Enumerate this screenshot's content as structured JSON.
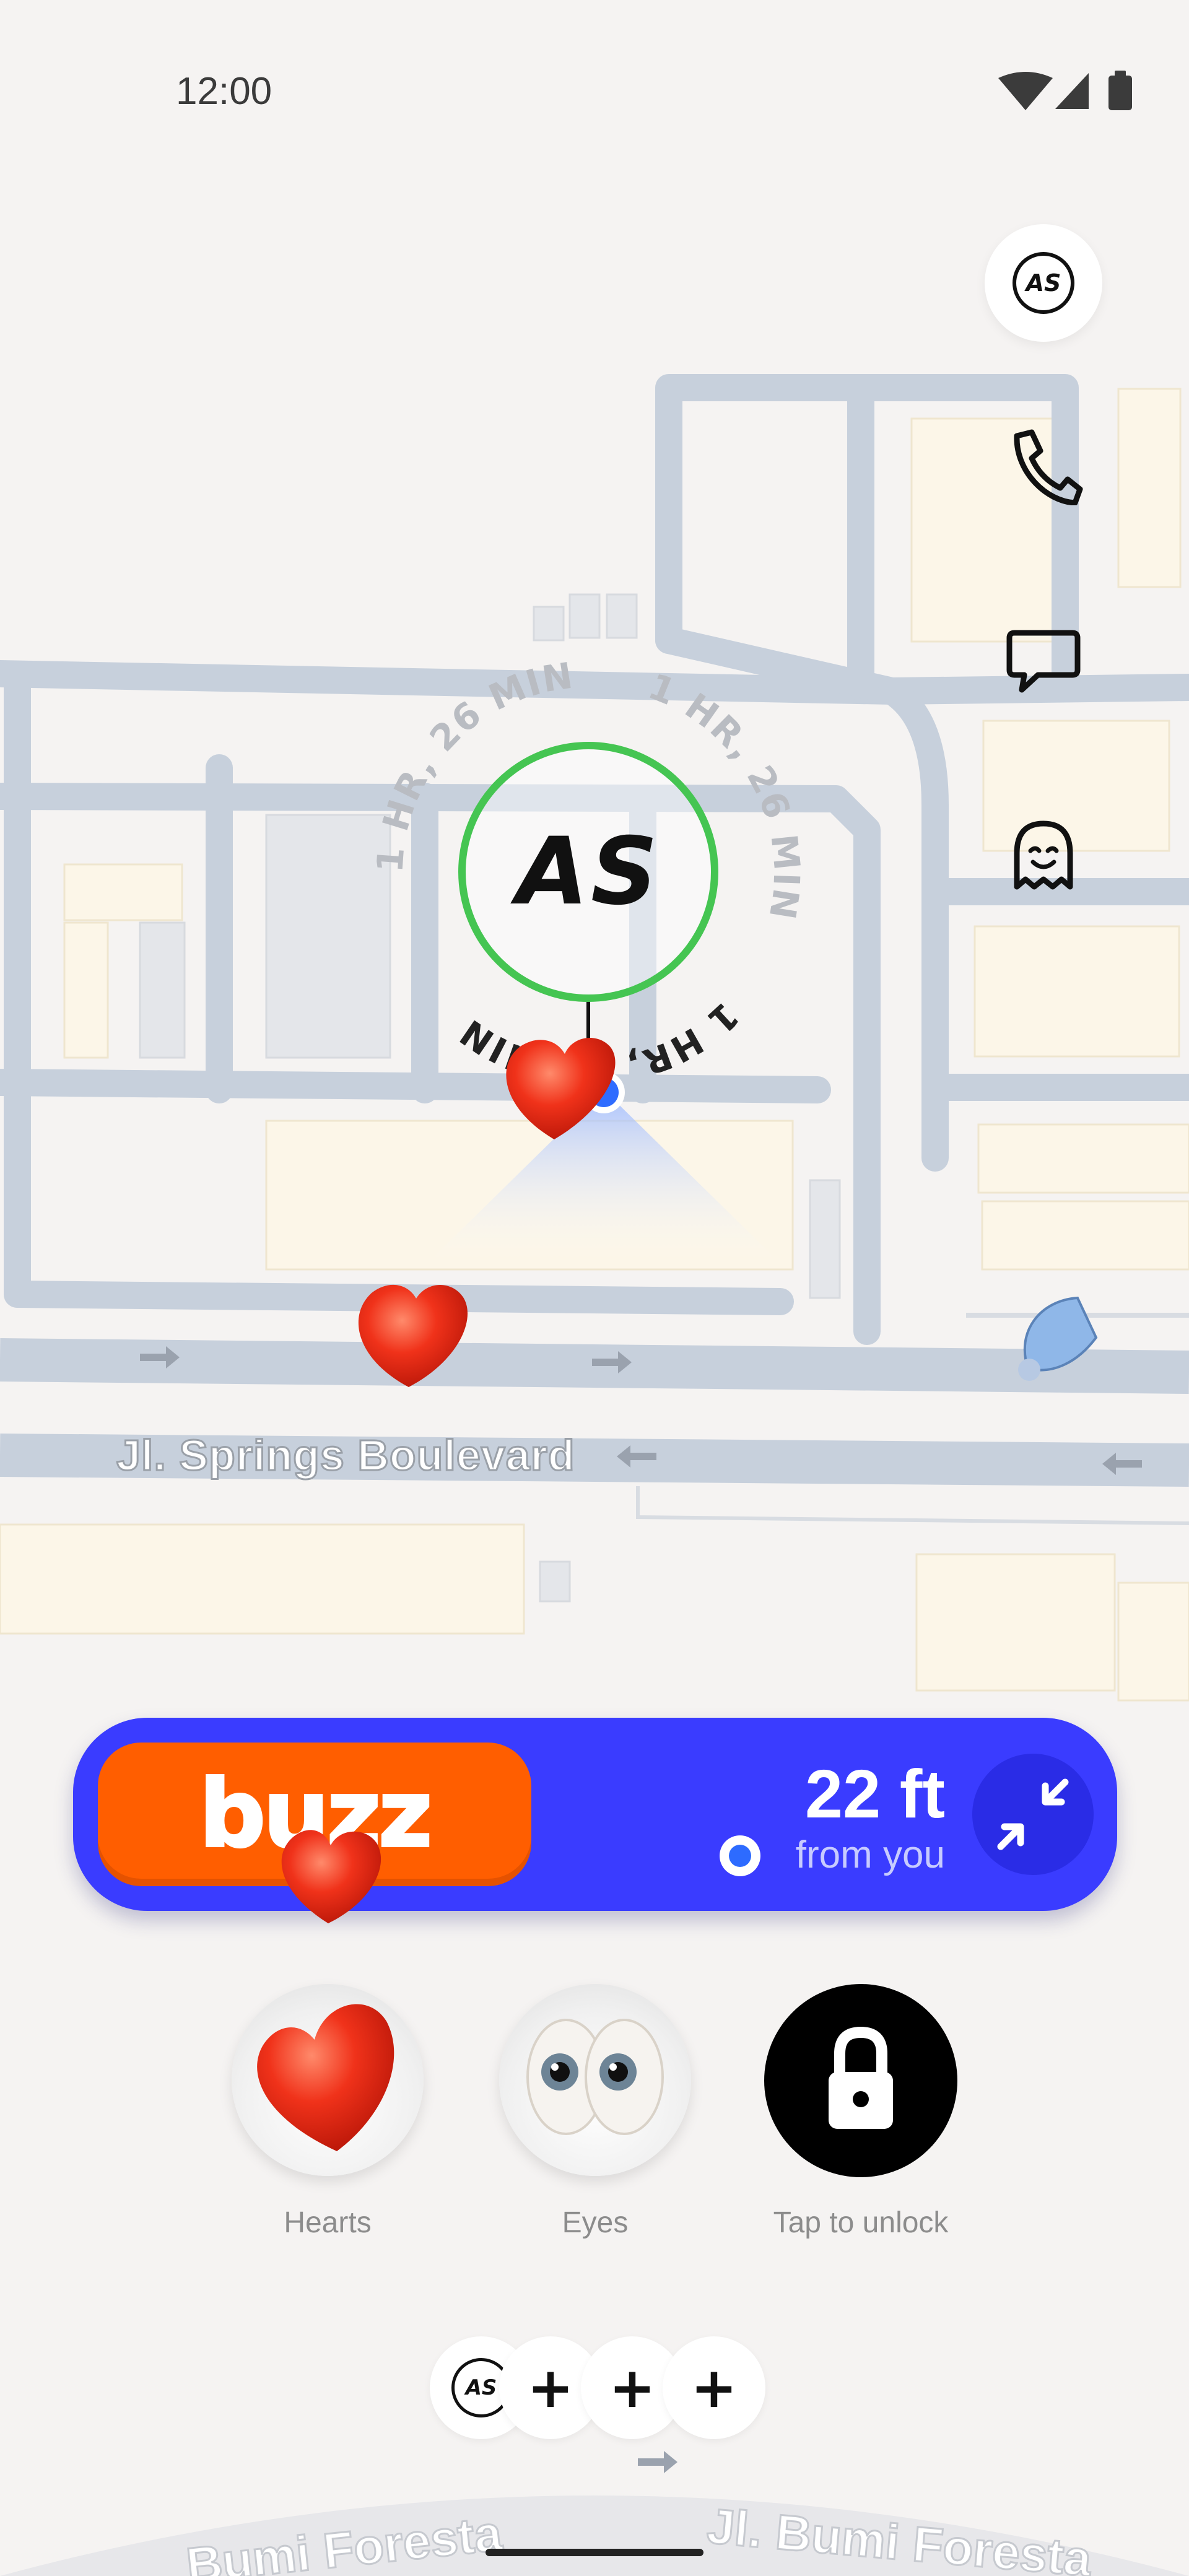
{
  "status_bar": {
    "time": "12:00"
  },
  "map": {
    "friend": {
      "initials": "AS",
      "eta_text": "1 HR, 26 MIN"
    },
    "street_label": "Jl. Springs Boulevard",
    "bottom_street_left": "Bumi Foresta",
    "bottom_street_right": "Jl. Bumi Foresta"
  },
  "right_rail": {
    "avatar_initials": "AS",
    "icons": [
      "phone-icon",
      "chat-icon",
      "ghost-icon"
    ]
  },
  "buzz_bar": {
    "button_label": "buzz",
    "distance": "22 ft",
    "distance_caption": "from you"
  },
  "reactions": [
    {
      "label": "Hearts",
      "icon": "heart-icon"
    },
    {
      "label": "Eyes",
      "icon": "eyes-icon"
    },
    {
      "label": "Tap to unlock",
      "icon": "lock-icon"
    }
  ],
  "friend_bar": {
    "avatar_initials": "AS",
    "add_glyph": "+"
  },
  "colors": {
    "buzz_bar": "#3a3cff",
    "buzz_button": "#ff5e00",
    "friend_ring": "#45c552",
    "road": "#c7d0dc",
    "building": "#fbf6e8"
  }
}
